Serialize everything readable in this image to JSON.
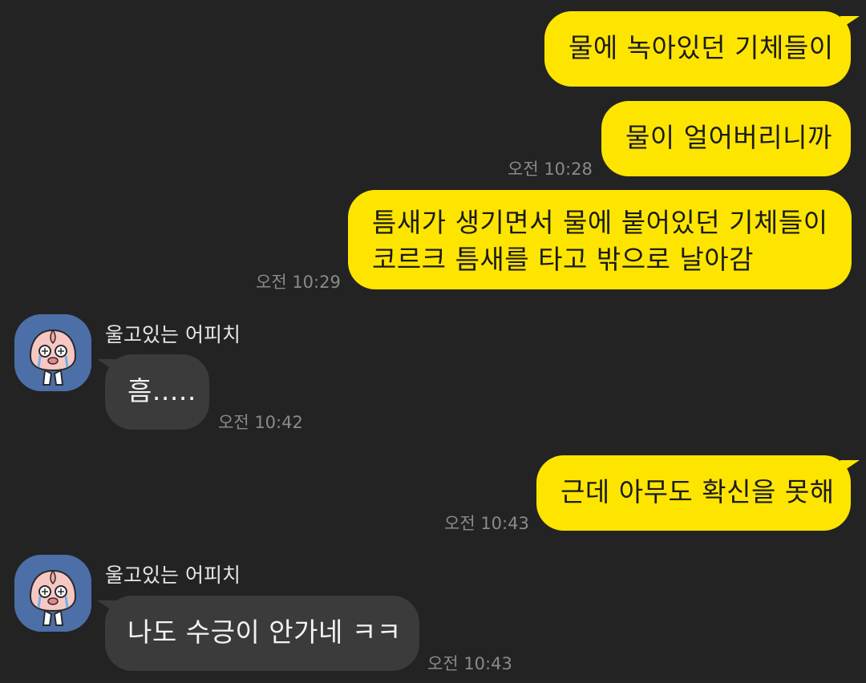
{
  "colors": {
    "background": "#232323",
    "outgoing_bubble": "#fee500",
    "incoming_bubble": "#3b3b3b",
    "timestamp": "#8a8a8a",
    "avatar_bg": "#4d6fa8"
  },
  "messages": [
    {
      "direction": "out",
      "text": "물에 녹아있던 기체들이"
    },
    {
      "direction": "out",
      "text": "물이 얼어버리니까",
      "time": "오전 10:28"
    },
    {
      "direction": "out",
      "lines": [
        "틈새가 생기면서 물에 붙어있던 기체들이",
        "코르크 틈새를 타고 밖으로 날아감"
      ],
      "time": "오전 10:29"
    },
    {
      "direction": "in",
      "sender": "울고있는 어피치",
      "avatar_icon": "crying-peach-avatar-icon",
      "text": "흠.....",
      "time": "오전 10:42"
    },
    {
      "direction": "out",
      "text": "근데 아무도 확신을 못해",
      "time": "오전 10:43"
    },
    {
      "direction": "in",
      "sender": "울고있는 어피치",
      "avatar_icon": "crying-peach-avatar-icon",
      "text": "나도 수긍이 안가네 ㅋㅋ",
      "time": "오전 10:43"
    }
  ]
}
